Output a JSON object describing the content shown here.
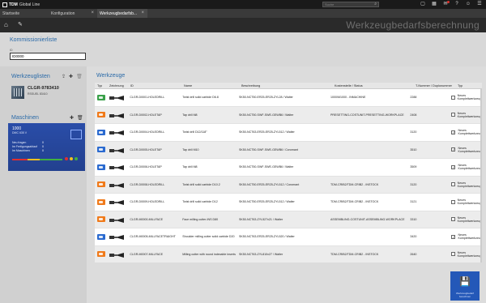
{
  "app": {
    "brand": "TDM",
    "brand_sub": "Global Line"
  },
  "search": {
    "placeholder": "Suche"
  },
  "tabs": [
    {
      "label": "Startseite"
    },
    {
      "label": "Konfiguration"
    },
    {
      "label": "Werkzeugbedarfsb..."
    }
  ],
  "page": {
    "heading": "Werkzeugbedarfsberechnung"
  },
  "commission": {
    "title": "Kommissionierliste",
    "small_label": "ID",
    "value": "ID0000"
  },
  "toollists": {
    "title": "Werkzeuglisten",
    "item_name": "CLGR-9783410",
    "item_sub": "RSSUEL 83410"
  },
  "machines": {
    "title": "Maschinen",
    "card_name": "1000",
    "card_sub": "DMC 635 V",
    "line1": "Neu fragen",
    "line2": "Im Fertigungsablauf",
    "line3": "Im Maschinen",
    "val1": "0",
    "val2": "0",
    "val3": "0"
  },
  "tools": {
    "title": "Werkzeuge",
    "columns": {
      "type": "Typ",
      "drawing": "Zeichnung",
      "id": "ID",
      "name": "Name",
      "desc": "Beschreibung",
      "loc": "Kostenstelle / Status",
      "num": "T-Nummer / Duplonummer",
      "kind": "Typ"
    },
    "rows": [
      {
        "color": "#3aa14a",
        "id": "CLGR-D0001-HOLEDRILL",
        "name": "Twist drill solid carbide D6.8",
        "desc": "SK50-NCT50-ER25-ER25-ZYL28 / Walter",
        "loc": "1000/M1000 - INMACHINE",
        "num": "2288",
        "checked": false,
        "kind": "Neues Komplettwerkzeug"
      },
      {
        "color": "#f07a1a",
        "id": "CLGR-D0002-HOLETAP",
        "name": "Tap drill M8",
        "desc": "SK50-NCT50-SWF-SWE-GEWB6 / Walter",
        "loc": "PRESETTING-COSTUNIT-PRESETTING-WORKPLACE",
        "num": "2408",
        "checked": false,
        "kind": "Neues Komplettwerkzeug"
      },
      {
        "color": "#2a6ad0",
        "id": "CLGR-D0004-HOLEDRILL",
        "name": "Twist drill D12/118°",
        "desc": "SK50-NCT63-ER25-ER25-ZYL512 / Walter",
        "loc": "",
        "num": "3120",
        "checked": true,
        "kind": "Neues Komplettwerkzeug"
      },
      {
        "color": "#2a6ad0",
        "id": "CLGR-D0005-HOLETAP",
        "name": "Tap drill M10",
        "desc": "SK50-NCT50-SWF-SWE-GEWB6 / Coromant",
        "loc": "",
        "num": "3510",
        "checked": true,
        "kind": "Neues Komplettwerkzeug"
      },
      {
        "color": "#2a6ad0",
        "id": "CLGR-D0006-HOLETAP",
        "name": "Tap drill M8",
        "desc": "SK50-NCT50-SWF-SWE-GEWB6 / Walter",
        "loc": "",
        "num": "3509",
        "checked": true,
        "kind": "Neues Komplettwerkzeug"
      },
      {
        "color": "#f07a1a",
        "id": "CLGR-D0008-HOLEDRILL",
        "name": "Twist drill solid carbide D10.2",
        "desc": "SK50-NCT50-ER25-ER25-ZYL512 / Coromant",
        "loc": "TDM-CRIB2/TDM-CRIB2 - INSTOCK",
        "num": "3120",
        "checked": false,
        "kind": "Neues Komplettwerkzeug"
      },
      {
        "color": "#f07a1a",
        "id": "CLGR-D0009-HOLEDRILL",
        "name": "Twist drill solid carbide D12",
        "desc": "SK50-NCT50-ER25-ER25-ZYL512 / Walter",
        "loc": "TDM-CRIB2/TDM-CRIB2 - INSTOCK",
        "num": "3121",
        "checked": false,
        "kind": "Neues Komplettwerkzeug"
      },
      {
        "color": "#f07a1a",
        "id": "CLGR-M0000-MILLFACE",
        "name": "Face milling cutter-INS D80",
        "desc": "SK50-NCT63-ZYL527x21 / Walter",
        "loc": "ASSEMBLING-COSTUNIT-ASSEMBLING-WORKPLACE",
        "num": "3310",
        "checked": false,
        "kind": "Neues Komplettwerkzeug"
      },
      {
        "color": "#2a6ad0",
        "id": "CLGR-M0005-MILLFACETRAIGHT",
        "name": "Shoulder milling cutter solid carbide D20",
        "desc": "SK50-NCT63-ER25-ER25-ZYL520 / Walter",
        "loc": "",
        "num": "3420",
        "checked": true,
        "kind": "Neues Komplettwerkzeug"
      },
      {
        "color": "#f07a1a",
        "id": "CLGR-M0007-MILLFACE",
        "name": "Milling cutter with round indexable inserts",
        "desc": "SK50-NCT63-ZYL810x27 / Walter",
        "loc": "TDM-CRIB2/TDM-CRIB2 - INSTOCK",
        "num": "2640",
        "checked": false,
        "kind": "Neues Komplettwerkzeug"
      }
    ]
  },
  "save": {
    "label": "Werkzeugbedarf berechnen"
  },
  "icons": {
    "home": "home-icon",
    "tool": "wrench-icon",
    "search": "search-icon",
    "close": "close-icon",
    "save": "floppy-icon"
  }
}
